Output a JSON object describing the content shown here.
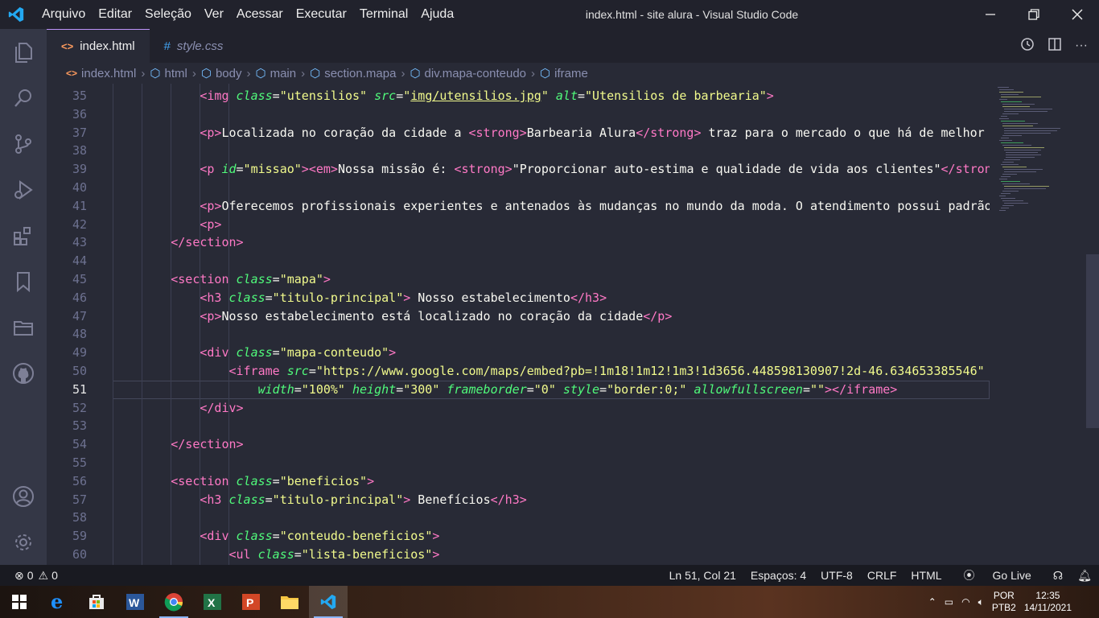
{
  "window": {
    "title": "index.html - site alura - Visual Studio Code",
    "menu": [
      "Arquivo",
      "Editar",
      "Seleção",
      "Ver",
      "Acessar",
      "Executar",
      "Terminal",
      "Ajuda"
    ]
  },
  "tabs": [
    {
      "label": "index.html",
      "icon": "html-file-icon",
      "active": true
    },
    {
      "label": "style.css",
      "icon": "css-file-icon",
      "active": false
    }
  ],
  "breadcrumb": [
    "index.html",
    "html",
    "body",
    "main",
    "section.mapa",
    "div.mapa-conteudo",
    "iframe"
  ],
  "editor": {
    "lines": [
      {
        "n": "35",
        "indent": 4,
        "html": "<span class='t'>&lt;img</span> <span class='a'>class</span>=<span class='s'>\"utensilios\"</span> <span class='a'>src</span>=<span class='s'>\"<span class='u'>img/utensilios.jpg</span>\"</span> <span class='a'>alt</span>=<span class='s'>\"Utensilios de barbearia\"</span><span class='t'>&gt;</span>"
      },
      {
        "n": "36",
        "indent": 0,
        "html": ""
      },
      {
        "n": "37",
        "indent": 4,
        "html": "<span class='t'>&lt;p&gt;</span>Localizada no coração da cidade a <span class='t'>&lt;strong&gt;</span>Barbearia Alura<span class='t'>&lt;/strong&gt;</span> traz para o mercado o que há de melhor para o seu cabelo e barba."
      },
      {
        "n": "38",
        "indent": 0,
        "html": ""
      },
      {
        "n": "39",
        "indent": 4,
        "html": "<span class='t'>&lt;p</span> <span class='a'>id</span>=<span class='s'>\"missao\"</span><span class='t'>&gt;&lt;em&gt;</span>Nossa missão é: <span class='t'>&lt;strong&gt;</span>\"Proporcionar auto-estima e qualidade de vida aos clientes\"<span class='t'>&lt;/strong&gt;</span>"
      },
      {
        "n": "40",
        "indent": 0,
        "html": ""
      },
      {
        "n": "41",
        "indent": 4,
        "html": "<span class='t'>&lt;p&gt;</span>Oferecemos profissionais experientes e antenados às mudanças no mundo da moda. O atendimento possui padrão de excelência"
      },
      {
        "n": "42",
        "indent": 4,
        "html": "<span class='t'>&lt;p&gt;</span>"
      },
      {
        "n": "43",
        "indent": 3,
        "html": "<span class='t'>&lt;/section&gt;</span>"
      },
      {
        "n": "44",
        "indent": 0,
        "html": ""
      },
      {
        "n": "45",
        "indent": 3,
        "html": "<span class='t'>&lt;section</span> <span class='a'>class</span>=<span class='s'>\"mapa\"</span><span class='t'>&gt;</span>"
      },
      {
        "n": "46",
        "indent": 4,
        "html": "<span class='t'>&lt;h3</span> <span class='a'>class</span>=<span class='s'>\"titulo-principal\"</span><span class='t'>&gt;</span> Nosso estabelecimento<span class='t'>&lt;/h3&gt;</span>"
      },
      {
        "n": "47",
        "indent": 4,
        "html": "<span class='t'>&lt;p&gt;</span>Nosso estabelecimento está localizado no coração da cidade<span class='t'>&lt;/p&gt;</span>"
      },
      {
        "n": "48",
        "indent": 0,
        "html": ""
      },
      {
        "n": "49",
        "indent": 4,
        "html": "<span class='t'>&lt;div</span> <span class='a'>class</span>=<span class='s'>\"mapa-conteudo\"</span><span class='t'>&gt;</span>"
      },
      {
        "n": "50",
        "indent": 5,
        "html": "<span class='t'>&lt;iframe</span> <span class='a'>src</span>=<span class='s'>\"https://www.google.com/maps/embed?pb=!1m18!1m12!1m3!1d3656.448598130907!2d-46.634653385546\"</span>"
      },
      {
        "n": "51",
        "indent": 6,
        "html": "<span class='a'>width</span>=<span class='s'>\"100%\"</span> <span class='a'>height</span>=<span class='s'>\"300\"</span> <span class='a'>frameborder</span>=<span class='s'>\"0\"</span> <span class='a'>style</span>=<span class='s'>\"border:0;\"</span> <span class='a'>allowfullscreen</span>=<span class='s'>\"\"</span><span class='t'>&gt;&lt;/iframe&gt;</span>"
      },
      {
        "n": "52",
        "indent": 4,
        "html": "<span class='t'>&lt;/div&gt;</span>"
      },
      {
        "n": "53",
        "indent": 0,
        "html": ""
      },
      {
        "n": "54",
        "indent": 3,
        "html": "<span class='t'>&lt;/section&gt;</span>"
      },
      {
        "n": "55",
        "indent": 0,
        "html": ""
      },
      {
        "n": "56",
        "indent": 3,
        "html": "<span class='t'>&lt;section</span> <span class='a'>class</span>=<span class='s'>\"beneficios\"</span><span class='t'>&gt;</span>"
      },
      {
        "n": "57",
        "indent": 4,
        "html": "<span class='t'>&lt;h3</span> <span class='a'>class</span>=<span class='s'>\"titulo-principal\"</span><span class='t'>&gt;</span> Benefícios<span class='t'>&lt;/h3&gt;</span>"
      },
      {
        "n": "58",
        "indent": 0,
        "html": ""
      },
      {
        "n": "59",
        "indent": 4,
        "html": "<span class='t'>&lt;div</span> <span class='a'>class</span>=<span class='s'>\"conteudo-beneficios\"</span><span class='t'>&gt;</span>"
      },
      {
        "n": "60",
        "indent": 5,
        "html": "<span class='t'>&lt;ul</span> <span class='a'>class</span>=<span class='s'>\"lista-beneficios\"</span><span class='t'>&gt;</span>"
      }
    ],
    "current_line": "51"
  },
  "statusbar": {
    "errors": "0",
    "warnings": "0",
    "position": "Ln 51, Col 21",
    "spaces": "Espaços: 4",
    "encoding": "UTF-8",
    "eol": "CRLF",
    "language": "HTML",
    "golive": "Go Live"
  },
  "taskbar": {
    "apps": [
      "windows-start-icon",
      "edge-icon",
      "store-icon",
      "word-icon",
      "chrome-icon",
      "excel-icon",
      "powerpoint-icon",
      "file-explorer-icon",
      "vscode-icon"
    ],
    "lang_top": "POR",
    "lang_bottom": "PTB2",
    "time": "12:35",
    "date": "14/11/2021"
  },
  "colors": {
    "tag": "#ff79c6",
    "attr": "#50fa7b",
    "string": "#f1fa8c",
    "editor_bg": "#282a36",
    "accent": "#bd93f9"
  }
}
